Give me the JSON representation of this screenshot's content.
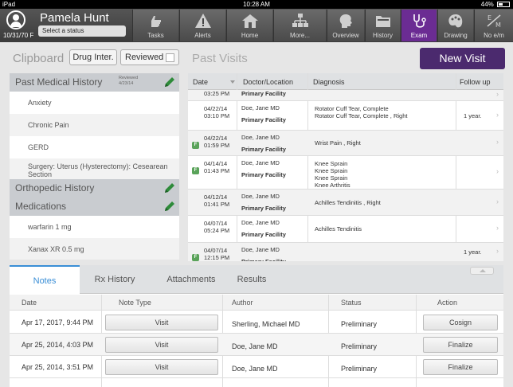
{
  "statusbar": {
    "device": "iPad",
    "time": "10:28 AM",
    "battery": "44%",
    "battery_level": 0.44
  },
  "patient": {
    "name": "Pamela  Hunt",
    "dob_sex": "10/31/70 F",
    "status_placeholder": "Select a status"
  },
  "nav": {
    "items": [
      {
        "label": "Tasks",
        "icon": "hand-icon"
      },
      {
        "label": "Alerts",
        "icon": "warning-icon"
      },
      {
        "label": "Home",
        "icon": "home-icon"
      },
      {
        "label": "More...",
        "icon": "sitemap-icon"
      },
      {
        "label": "Overview",
        "icon": "head-profile-icon"
      },
      {
        "label": "History",
        "icon": "folder-icon"
      },
      {
        "label": "Exam",
        "icon": "stethoscope-icon",
        "active": true
      },
      {
        "label": "Drawing",
        "icon": "palette-icon"
      },
      {
        "label": "No e/m",
        "icon": "em-icon"
      }
    ],
    "em_letters": {
      "e": "E",
      "m": "M"
    },
    "accent_color": "#6b2c93"
  },
  "toolbar": {
    "clipboard_title": "Clipboard",
    "drug_interactions": "Drug Inter.",
    "reviewed": "Reviewed",
    "past_visits_title": "Past Visits",
    "new_visit": "New Visit"
  },
  "clipboard": {
    "pmh": {
      "title": "Past Medical History",
      "reviewed_label": "Reviewed",
      "reviewed_date": "4/23/14",
      "items": [
        "Anxiety",
        "Chronic Pain",
        "GERD",
        "Surgery: Uterus (Hysterectomy): Cesearean Section"
      ]
    },
    "orthopedic": {
      "title": "Orthopedic History"
    },
    "medications": {
      "title": "Medications",
      "items": [
        "warfarin 1 mg",
        "Xanax XR 0.5 mg"
      ]
    }
  },
  "past_visits": {
    "columns": [
      "Date",
      "Doctor/Location",
      "Diagnosis",
      "Follow up"
    ],
    "rows": [
      {
        "date": "",
        "time": "03:25 PM",
        "doctor": "",
        "location": "Primary Facility",
        "diagnosis": [],
        "follow_up": "",
        "flag": false
      },
      {
        "date": "04/22/14",
        "time": "03:10 PM",
        "doctor": "Doe, Jane MD",
        "location": "Primary Facility",
        "diagnosis": [
          "Rotator Cuff Tear, Complete",
          "Rotator Cuff Tear, Complete , Right"
        ],
        "follow_up": "1 year.",
        "flag": false
      },
      {
        "date": "04/22/14",
        "time": "01:59 PM",
        "doctor": "Doe, Jane MD",
        "location": "Primary Facility",
        "diagnosis": [
          "Wrist Pain , Right"
        ],
        "follow_up": "",
        "flag": true
      },
      {
        "date": "04/14/14",
        "time": "01:43 PM",
        "doctor": "Doe, Jane MD",
        "location": "Primary Facility",
        "diagnosis": [
          "Knee Sprain",
          "Knee Sprain",
          "Knee Sprain",
          "Knee Arthritis"
        ],
        "follow_up": "",
        "flag": true
      },
      {
        "date": "04/12/14",
        "time": "01:41 PM",
        "doctor": "Doe, Jane MD",
        "location": "Primary Facility",
        "diagnosis": [
          "Achilles Tendinitis , Right"
        ],
        "follow_up": "",
        "flag": false
      },
      {
        "date": "04/07/14",
        "time": "05:24 PM",
        "doctor": "Doe, Jane MD",
        "location": "Primary Facility",
        "diagnosis": [
          "Achilles Tendinitis"
        ],
        "follow_up": "",
        "flag": false
      },
      {
        "date": "04/07/14",
        "time": "12:15 PM",
        "doctor": "Doe, Jane MD",
        "location": "Primary Facility",
        "diagnosis": [],
        "follow_up": "1 year.",
        "flag": true
      }
    ],
    "flag_label": "F"
  },
  "bottom": {
    "tabs": [
      "Notes",
      "Rx History",
      "Attachments",
      "Results"
    ],
    "active_tab": 0,
    "notes_columns": [
      "Date",
      "Note Type",
      "Author",
      "Status",
      "Action"
    ],
    "notes": [
      {
        "date": "Apr 17, 2017, 9:44 PM",
        "type": "Visit",
        "author": "Sherling, Michael MD",
        "status": "Preliminary",
        "action": "Cosign"
      },
      {
        "date": "Apr 25, 2014, 4:03 PM",
        "type": "Visit",
        "author": "Doe, Jane MD",
        "status": "Preliminary",
        "action": "Finalize"
      },
      {
        "date": "Apr 25, 2014, 3:51 PM",
        "type": "Visit",
        "author": "Doe, Jane MD",
        "status": "Preliminary",
        "action": "Finalize"
      }
    ]
  }
}
